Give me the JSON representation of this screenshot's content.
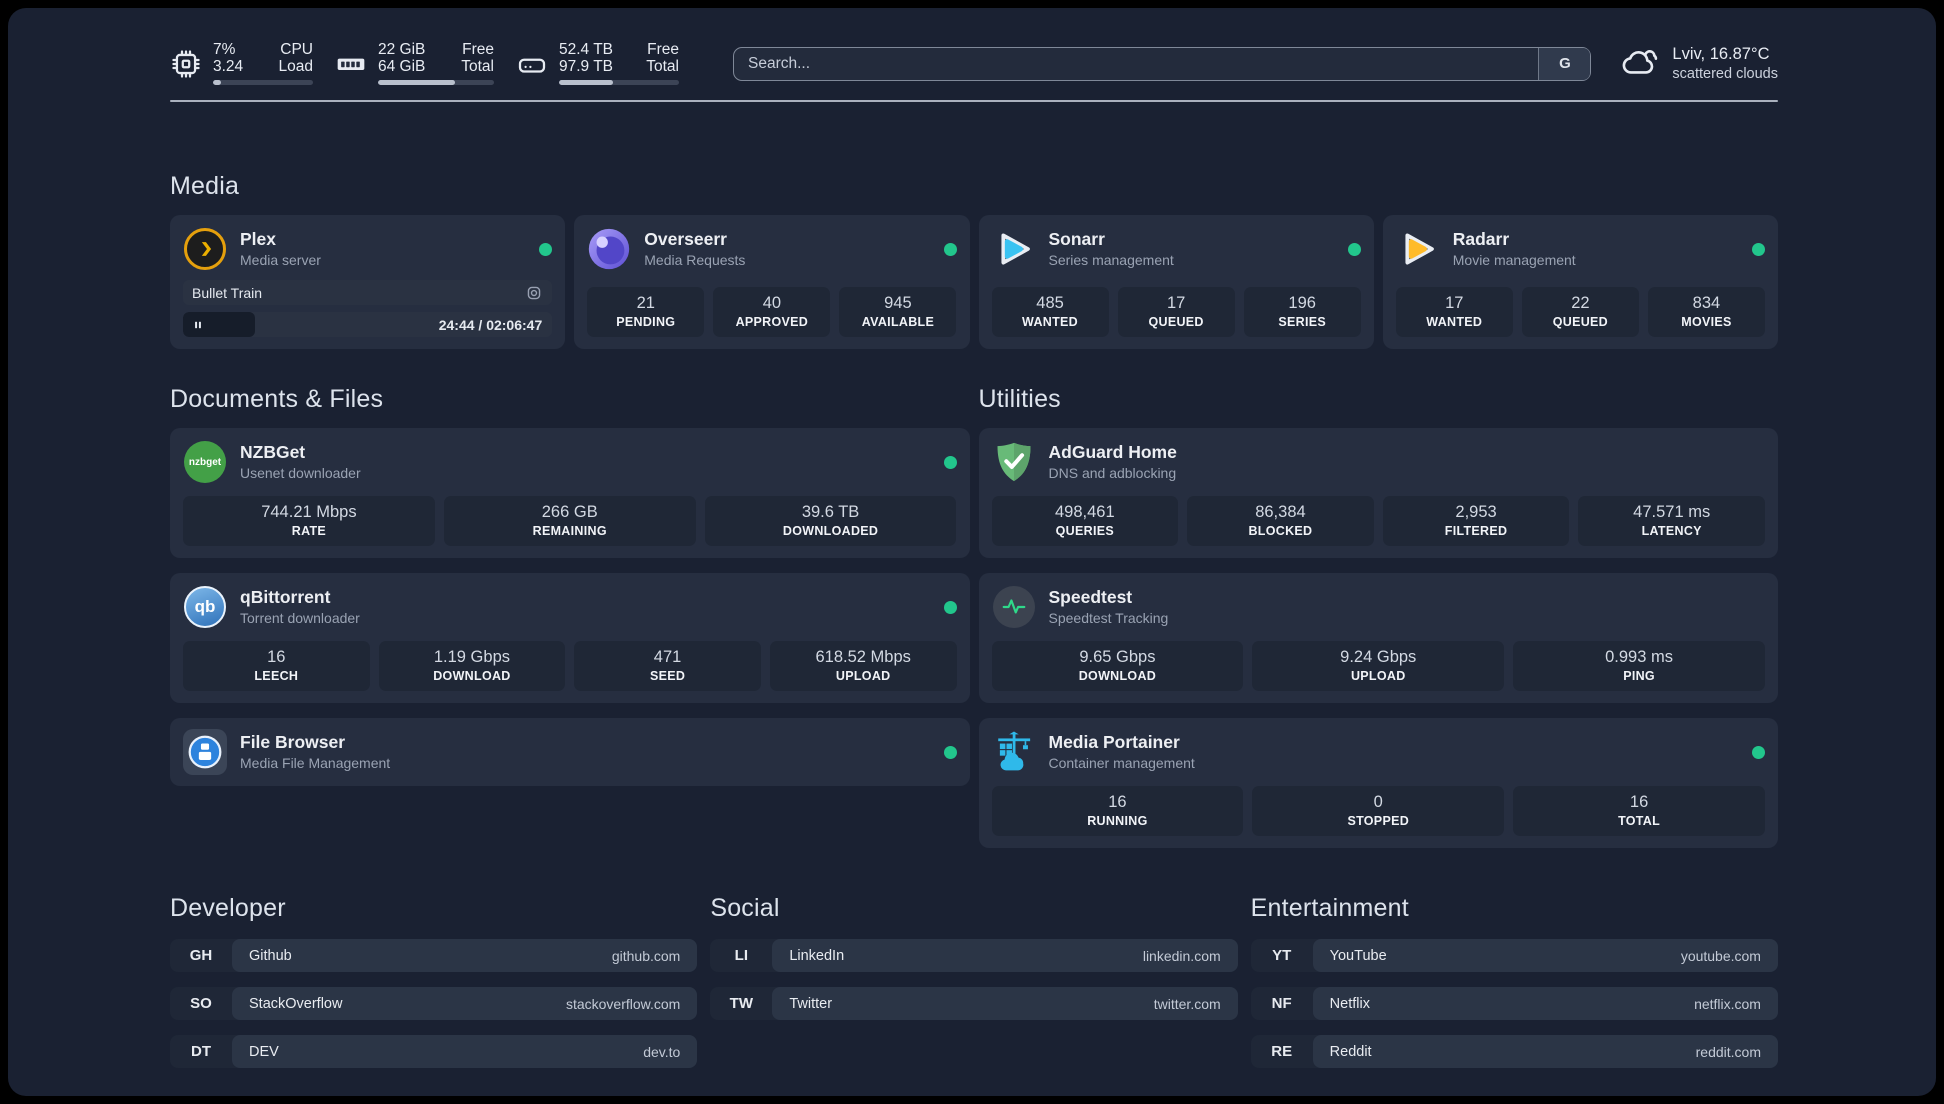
{
  "topbar": {
    "resources": [
      {
        "icon": "cpu-icon",
        "values": [
          "7%",
          "3.24"
        ],
        "labels": [
          "CPU",
          "Load"
        ],
        "progress_pct": 8
      },
      {
        "icon": "ram-icon",
        "values": [
          "22 GiB",
          "64 GiB"
        ],
        "labels": [
          "Free",
          "Total"
        ],
        "progress_pct": 66
      },
      {
        "icon": "disk-icon",
        "values": [
          "52.4 TB",
          "97.9 TB"
        ],
        "labels": [
          "Free",
          "Total"
        ],
        "progress_pct": 45
      }
    ],
    "search": {
      "placeholder": "Search...",
      "engine_button": "G"
    },
    "weather": {
      "icon": "cloud-icon",
      "location_temp": "Lviv, 16.87°C",
      "condition": "scattered clouds"
    }
  },
  "media": {
    "title": "Media",
    "services": [
      {
        "icon": "plex-icon",
        "name": "Plex",
        "description": "Media server",
        "online": true,
        "now_playing": {
          "title": "Bullet Train",
          "time": "24:44 / 02:06:47",
          "progress_pct": 19.5,
          "state": "paused"
        }
      },
      {
        "icon": "overseerr-icon",
        "name": "Overseerr",
        "description": "Media Requests",
        "online": true,
        "stats": [
          {
            "value": "21",
            "label": "PENDING"
          },
          {
            "value": "40",
            "label": "APPROVED"
          },
          {
            "value": "945",
            "label": "AVAILABLE"
          }
        ]
      },
      {
        "icon": "sonarr-icon",
        "name": "Sonarr",
        "description": "Series management",
        "online": true,
        "stats": [
          {
            "value": "485",
            "label": "WANTED"
          },
          {
            "value": "17",
            "label": "QUEUED"
          },
          {
            "value": "196",
            "label": "SERIES"
          }
        ]
      },
      {
        "icon": "radarr-icon",
        "name": "Radarr",
        "description": "Movie management",
        "online": true,
        "stats": [
          {
            "value": "17",
            "label": "WANTED"
          },
          {
            "value": "22",
            "label": "QUEUED"
          },
          {
            "value": "834",
            "label": "MOVIES"
          }
        ]
      }
    ]
  },
  "documents": {
    "title": "Documents & Files",
    "services": [
      {
        "icon": "nzbget-icon",
        "name": "NZBGet",
        "description": "Usenet downloader",
        "online": true,
        "stats": [
          {
            "value": "744.21 Mbps",
            "label": "RATE"
          },
          {
            "value": "266 GB",
            "label": "REMAINING"
          },
          {
            "value": "39.6 TB",
            "label": "DOWNLOADED"
          }
        ]
      },
      {
        "icon": "qbittorrent-icon",
        "name": "qBittorrent",
        "description": "Torrent downloader",
        "online": true,
        "stats": [
          {
            "value": "16",
            "label": "LEECH"
          },
          {
            "value": "1.19 Gbps",
            "label": "DOWNLOAD"
          },
          {
            "value": "471",
            "label": "SEED"
          },
          {
            "value": "618.52 Mbps",
            "label": "UPLOAD"
          }
        ]
      },
      {
        "icon": "filebrowser-icon",
        "name": "File Browser",
        "description": "Media File Management",
        "online": true
      }
    ]
  },
  "utilities": {
    "title": "Utilities",
    "services": [
      {
        "icon": "adguard-icon",
        "name": "AdGuard Home",
        "description": "DNS and adblocking",
        "online": false,
        "stats": [
          {
            "value": "498,461",
            "label": "QUERIES"
          },
          {
            "value": "86,384",
            "label": "BLOCKED"
          },
          {
            "value": "2,953",
            "label": "FILTERED"
          },
          {
            "value": "47.571 ms",
            "label": "LATENCY"
          }
        ]
      },
      {
        "icon": "speedtest-icon",
        "name": "Speedtest",
        "description": "Speedtest Tracking",
        "online": false,
        "stats": [
          {
            "value": "9.65 Gbps",
            "label": "DOWNLOAD"
          },
          {
            "value": "9.24 Gbps",
            "label": "UPLOAD"
          },
          {
            "value": "0.993 ms",
            "label": "PING"
          }
        ]
      },
      {
        "icon": "portainer-icon",
        "name": "Media Portainer",
        "description": "Container management",
        "online": true,
        "stats": [
          {
            "value": "16",
            "label": "RUNNING"
          },
          {
            "value": "0",
            "label": "STOPPED"
          },
          {
            "value": "16",
            "label": "TOTAL"
          }
        ]
      }
    ]
  },
  "bookmarks": [
    {
      "title": "Developer",
      "items": [
        {
          "abbr": "GH",
          "name": "Github",
          "url": "github.com"
        },
        {
          "abbr": "SO",
          "name": "StackOverflow",
          "url": "stackoverflow.com"
        },
        {
          "abbr": "DT",
          "name": "DEV",
          "url": "dev.to"
        }
      ]
    },
    {
      "title": "Social",
      "items": [
        {
          "abbr": "LI",
          "name": "LinkedIn",
          "url": "linkedin.com"
        },
        {
          "abbr": "TW",
          "name": "Twitter",
          "url": "twitter.com"
        }
      ]
    },
    {
      "title": "Entertainment",
      "items": [
        {
          "abbr": "YT",
          "name": "YouTube",
          "url": "youtube.com"
        },
        {
          "abbr": "NF",
          "name": "Netflix",
          "url": "netflix.com"
        },
        {
          "abbr": "RE",
          "name": "Reddit",
          "url": "reddit.com"
        }
      ]
    }
  ],
  "colors": {
    "status_online": "#22c68c",
    "plex": "#e5a00d",
    "sonarr": "#3ac3f2",
    "radarr": "#ffbb2a",
    "nzbget": "#43a047",
    "qbittorrent": "#4a90d9",
    "adguard": "#68ba78",
    "speedtest_pulse": "#2fd98a",
    "portainer": "#2fb9ea",
    "filebrowser": "#2d83dd"
  }
}
